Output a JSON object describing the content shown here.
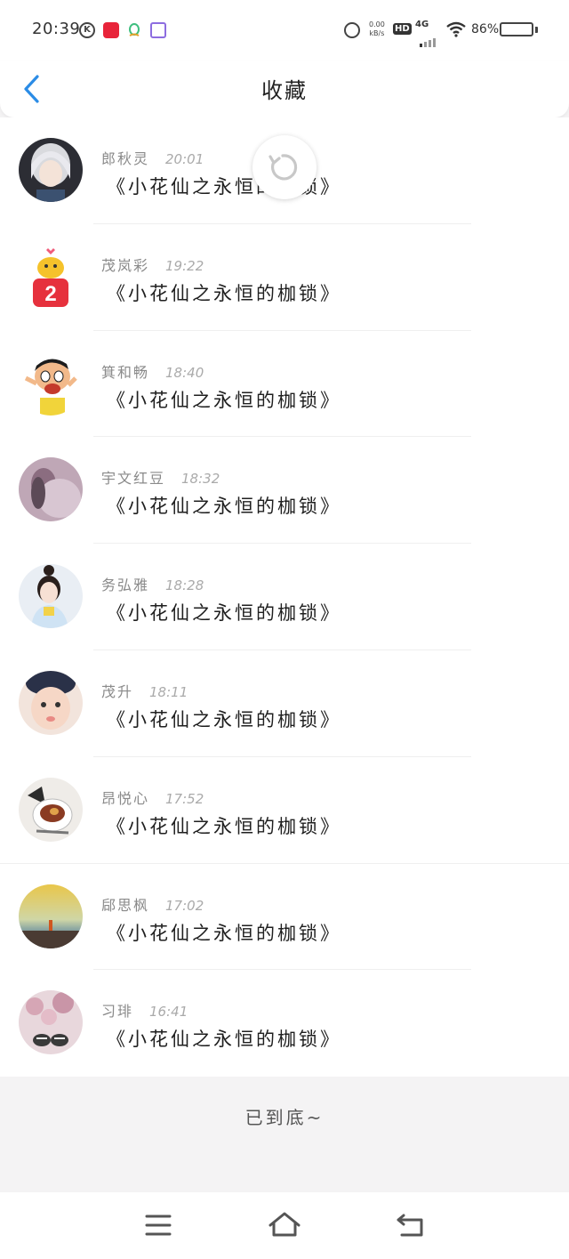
{
  "status_bar": {
    "time": "20:39",
    "app_icons": [
      "k-circle-icon",
      "xiaohongshu-icon",
      "qq-icon",
      "grid-app-icon"
    ],
    "net_speed_value": "0.00",
    "net_speed_unit": "kB/s",
    "hd_label": "HD",
    "network_label": "4G",
    "battery_percent": "86%",
    "battery_level": 0.86,
    "battery_color": "#3a8de0"
  },
  "header": {
    "title": "收藏",
    "back_icon": "chevron-left-icon",
    "accent_color": "#2b8ce6"
  },
  "favorites": [
    {
      "name": "郎秋灵",
      "time": "20:01",
      "book": "《小花仙之永恒的枷锁》"
    },
    {
      "name": "茂岚彩",
      "time": "19:22",
      "book": "《小花仙之永恒的枷锁》"
    },
    {
      "name": "箕和畅",
      "time": "18:40",
      "book": "《小花仙之永恒的枷锁》"
    },
    {
      "name": "宇文红豆",
      "time": "18:32",
      "book": "《小花仙之永恒的枷锁》"
    },
    {
      "name": "务弘雅",
      "time": "18:28",
      "book": "《小花仙之永恒的枷锁》"
    },
    {
      "name": "茂升",
      "time": "18:11",
      "book": "《小花仙之永恒的枷锁》"
    },
    {
      "name": "昂悦心",
      "time": "17:52",
      "book": "《小花仙之永恒的枷锁》"
    },
    {
      "name": "郈思枫",
      "time": "17:02",
      "book": "《小花仙之永恒的枷锁》"
    },
    {
      "name": "习琲",
      "time": "16:41",
      "book": "《小花仙之永恒的枷锁》"
    }
  ],
  "footer": {
    "end_text": "已到底~"
  },
  "system_nav": {
    "icons": [
      "menu-icon",
      "home-icon",
      "back-icon"
    ]
  }
}
